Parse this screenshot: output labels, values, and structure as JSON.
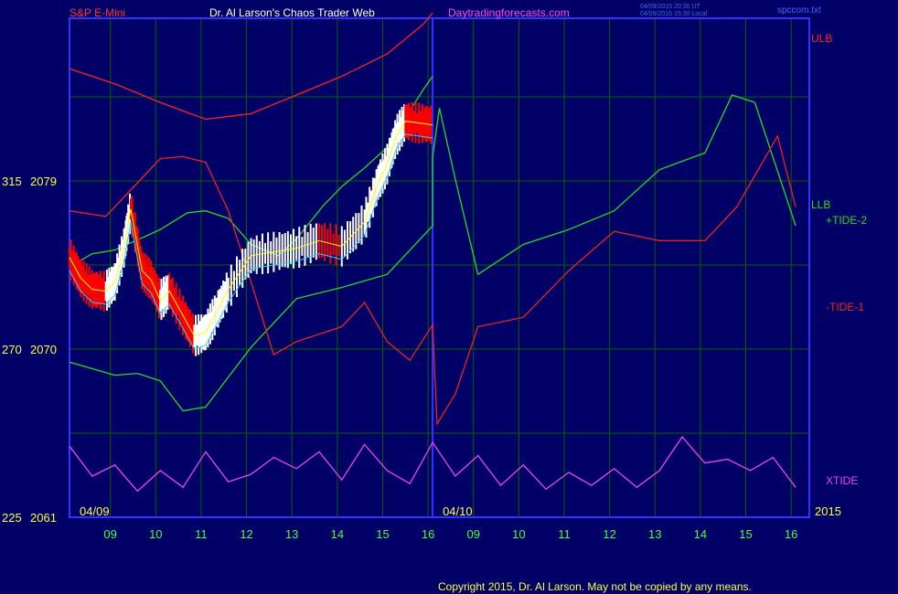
{
  "header": {
    "symbol": "S&P E-Mini",
    "title": "Dr. Al Larson's Chaos Trader Web",
    "site": "Daytradingforecasts.com",
    "time_ut": "04/09/2015 20:30 UT",
    "time_local": "04/09/2015 15:30 Local",
    "filename": "spccom.txt"
  },
  "footer": {
    "copyright": "Copyright 2015, Dr. Al Larson. May not be copied by any means."
  },
  "colors": {
    "background": "#000066",
    "frame": "#3333ff",
    "grid": "#006600",
    "price_up": "#ffffff",
    "price_down": "#ff0000",
    "ulb": "#ff2020",
    "llb": "#22dd22",
    "tide_plus": "#22dd22",
    "tide_minus": "#ee2222",
    "xtide": "#ee44ee",
    "cyan_avg": "#33ccff",
    "yellow_avg": "#ffff00",
    "hour_label": "#44ff44",
    "date_label": "#ffff44"
  },
  "chart_data": {
    "type": "line",
    "xlabel": "",
    "ylabel": "",
    "grid": true,
    "legend_placement": "right",
    "y_labels": [
      {
        "left": "315",
        "right": "2079",
        "value": 2079
      },
      {
        "left": "270",
        "right": "2070",
        "value": 2070
      },
      {
        "left": "225",
        "right": "2061",
        "value": 2061
      }
    ],
    "ylim": [
      2061,
      2079
    ],
    "x_ticks": [
      "09",
      "10",
      "11",
      "12",
      "13",
      "14",
      "15",
      "16",
      "09",
      "10",
      "11",
      "12",
      "13",
      "14",
      "15",
      "16"
    ],
    "date_labels": [
      {
        "text": "04/09",
        "tick": 0
      },
      {
        "text": "04/10",
        "tick": 8
      }
    ],
    "year_label": "2015",
    "xlim": [
      0,
      16.3
    ],
    "divider_x": 8,
    "series": [
      {
        "name": "ULB",
        "color": "ulb",
        "points": [
          [
            0,
            2085
          ],
          [
            1,
            2084.2
          ],
          [
            2,
            2083.2
          ],
          [
            3,
            2082.3
          ],
          [
            4,
            2082.6
          ],
          [
            5,
            2083.6
          ],
          [
            6,
            2084.6
          ],
          [
            7,
            2085.8
          ],
          [
            7.8,
            2087.4
          ],
          [
            8,
            2088.0
          ]
        ]
      },
      {
        "name": "LLB",
        "color": "llb",
        "points": [
          [
            0,
            2074.4
          ],
          [
            0.5,
            2075.1
          ],
          [
            1,
            2075.3
          ],
          [
            2,
            2076.4
          ],
          [
            2.6,
            2077.3
          ],
          [
            3,
            2077.4
          ],
          [
            3.5,
            2077.0
          ],
          [
            4,
            2075.6
          ],
          [
            4.6,
            2075.0
          ],
          [
            5,
            2075.9
          ],
          [
            5.6,
            2077.7
          ],
          [
            6,
            2078.7
          ],
          [
            6.5,
            2079.7
          ],
          [
            7,
            2080.8
          ],
          [
            7.4,
            2082.4
          ],
          [
            7.8,
            2083.9
          ],
          [
            8,
            2084.6
          ]
        ]
      },
      {
        "name": "+TIDE-2",
        "color": "tide_plus",
        "points": [
          [
            0,
            2069.3
          ],
          [
            1,
            2068.6
          ],
          [
            1.5,
            2068.7
          ],
          [
            2,
            2068.3
          ],
          [
            2.5,
            2066.7
          ],
          [
            3,
            2066.9
          ],
          [
            4,
            2070.1
          ],
          [
            5,
            2072.7
          ],
          [
            6,
            2073.3
          ],
          [
            7,
            2074.0
          ],
          [
            8,
            2076.6
          ],
          [
            8,
            2080.3
          ],
          [
            8.15,
            2082.9
          ],
          [
            8.5,
            2079.1
          ],
          [
            9,
            2074.0
          ],
          [
            10,
            2075.6
          ],
          [
            11,
            2076.4
          ],
          [
            12,
            2077.4
          ],
          [
            13,
            2079.6
          ],
          [
            14,
            2080.5
          ],
          [
            14.6,
            2083.6
          ],
          [
            15.1,
            2083.2
          ],
          [
            16,
            2076.6
          ]
        ]
      },
      {
        "name": "-TIDE-1",
        "color": "tide_minus",
        "points": [
          [
            0,
            2077.4
          ],
          [
            0.8,
            2077.1
          ],
          [
            1.5,
            2078.9
          ],
          [
            2,
            2080.2
          ],
          [
            2.5,
            2080.3
          ],
          [
            3,
            2080.0
          ],
          [
            3.5,
            2077.4
          ],
          [
            4,
            2073.6
          ],
          [
            4.5,
            2069.7
          ],
          [
            5,
            2070.4
          ],
          [
            6,
            2071.2
          ],
          [
            6.5,
            2072.5
          ],
          [
            7,
            2070.4
          ],
          [
            7.5,
            2069.4
          ],
          [
            8,
            2071.3
          ],
          [
            8.1,
            2066.0
          ],
          [
            8.5,
            2067.6
          ],
          [
            9,
            2071.2
          ],
          [
            10,
            2071.7
          ],
          [
            11,
            2074.2
          ],
          [
            12,
            2076.3
          ],
          [
            13,
            2075.8
          ],
          [
            14,
            2075.8
          ],
          [
            14.7,
            2077.6
          ],
          [
            15.6,
            2081.4
          ],
          [
            16,
            2077.6
          ]
        ]
      },
      {
        "name": "XTIDE",
        "color": "xtide",
        "points": [
          [
            0,
            2064.8
          ],
          [
            0.5,
            2063.2
          ],
          [
            1,
            2063.8
          ],
          [
            1.5,
            2062.4
          ],
          [
            2,
            2063.5
          ],
          [
            2.5,
            2062.6
          ],
          [
            3,
            2064.5
          ],
          [
            3.5,
            2062.9
          ],
          [
            4,
            2063.3
          ],
          [
            4.5,
            2064.2
          ],
          [
            5,
            2063.6
          ],
          [
            5.5,
            2064.5
          ],
          [
            6,
            2063.0
          ],
          [
            6.5,
            2064.9
          ],
          [
            7,
            2063.5
          ],
          [
            7.5,
            2062.8
          ],
          [
            8,
            2065.0
          ],
          [
            8.5,
            2063.2
          ],
          [
            9,
            2064.3
          ],
          [
            9.5,
            2062.7
          ],
          [
            10,
            2063.8
          ],
          [
            10.5,
            2062.5
          ],
          [
            11,
            2063.4
          ],
          [
            11.5,
            2062.7
          ],
          [
            12,
            2063.6
          ],
          [
            12.5,
            2062.6
          ],
          [
            13,
            2063.5
          ],
          [
            13.5,
            2065.3
          ],
          [
            14,
            2063.9
          ],
          [
            14.5,
            2064.1
          ],
          [
            15,
            2063.5
          ],
          [
            15.5,
            2064.2
          ],
          [
            16,
            2062.6
          ]
        ]
      }
    ],
    "price_series": {
      "name": "S&P E-Mini",
      "points": [
        [
          0,
          2074.9
        ],
        [
          0.25,
          2073.8
        ],
        [
          0.5,
          2073.2
        ],
        [
          0.8,
          2073.1
        ],
        [
          1,
          2073.6
        ],
        [
          1.2,
          2075.4
        ],
        [
          1.35,
          2077.5
        ],
        [
          1.6,
          2074.2
        ],
        [
          1.8,
          2073.7
        ],
        [
          2,
          2072.6
        ],
        [
          2.2,
          2073.1
        ],
        [
          2.5,
          2071.8
        ],
        [
          2.75,
          2070.7
        ],
        [
          3,
          2070.9
        ],
        [
          3.2,
          2071.8
        ],
        [
          3.5,
          2073.2
        ],
        [
          4,
          2075.0
        ],
        [
          4.5,
          2075.2
        ],
        [
          5,
          2075.4
        ],
        [
          5.5,
          2075.8
        ],
        [
          6,
          2075.5
        ],
        [
          6.5,
          2076.8
        ],
        [
          6.8,
          2078.9
        ],
        [
          7,
          2079.9
        ],
        [
          7.2,
          2081.4
        ],
        [
          7.4,
          2082.2
        ],
        [
          7.7,
          2082.1
        ],
        [
          8,
          2082.0
        ]
      ]
    }
  }
}
